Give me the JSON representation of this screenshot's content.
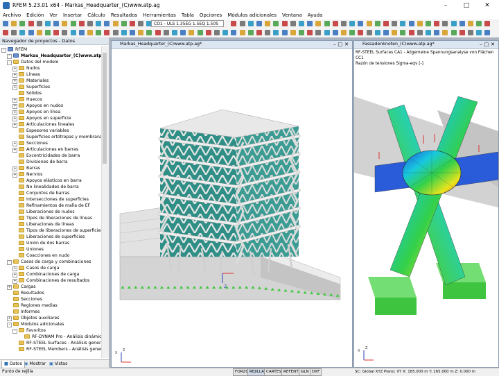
{
  "app": {
    "title": "RFEM 5.23.01 x64 - Markas_Headquarter_(C)www.atp.ag"
  },
  "menu": [
    "Archivo",
    "Edición",
    "Ver",
    "Insertar",
    "Cálculo",
    "Resultados",
    "Herramientas",
    "Tabla",
    "Opciones",
    "Módulos adicionales",
    "Ventana",
    "Ayuda"
  ],
  "toolbar": {
    "load_combo": "CO1 - ULS 1.35EG 1.5EQ 1.50S"
  },
  "navigator": {
    "title": "Navegador de proyectos - Datos",
    "root": "RFEM",
    "project": "Markas_Headquarter_(C)www.atp.ag*",
    "items": [
      {
        "label": "Datos del modelo",
        "level": 2,
        "exp": "-"
      },
      {
        "label": "Nudos",
        "level": 3,
        "exp": "+"
      },
      {
        "label": "Líneas",
        "level": 3,
        "exp": "+"
      },
      {
        "label": "Materiales",
        "level": 3,
        "exp": "+"
      },
      {
        "label": "Superficies",
        "level": 3,
        "exp": "+"
      },
      {
        "label": "Sólidos",
        "level": 3,
        "exp": ""
      },
      {
        "label": "Huecos",
        "level": 3,
        "exp": "+"
      },
      {
        "label": "Apoyos en nudos",
        "level": 3,
        "exp": "+"
      },
      {
        "label": "Apoyos en línea",
        "level": 3,
        "exp": "+"
      },
      {
        "label": "Apoyos en superficie",
        "level": 3,
        "exp": "+"
      },
      {
        "label": "Articulaciones lineales",
        "level": 3,
        "exp": "+"
      },
      {
        "label": "Espesores variables",
        "level": 3,
        "exp": ""
      },
      {
        "label": "Superficies ortótropas y membranas",
        "level": 3,
        "exp": ""
      },
      {
        "label": "Secciones",
        "level": 3,
        "exp": "+"
      },
      {
        "label": "Articulaciones en barras",
        "level": 3,
        "exp": "+"
      },
      {
        "label": "Excentricidades de barra",
        "level": 3,
        "exp": ""
      },
      {
        "label": "Divisiones de barra",
        "level": 3,
        "exp": ""
      },
      {
        "label": "Barras",
        "level": 3,
        "exp": "+"
      },
      {
        "label": "Nervios",
        "level": 3,
        "exp": "+"
      },
      {
        "label": "Apoyos elásticos en barra",
        "level": 3,
        "exp": ""
      },
      {
        "label": "No linealidades de barra",
        "level": 3,
        "exp": ""
      },
      {
        "label": "Conjuntos de barras",
        "level": 3,
        "exp": ""
      },
      {
        "label": "Intersecciones de superficies",
        "level": 3,
        "exp": ""
      },
      {
        "label": "Refinamientos de malla de EF",
        "level": 3,
        "exp": ""
      },
      {
        "label": "Liberaciones de nudos",
        "level": 3,
        "exp": ""
      },
      {
        "label": "Tipos de liberaciones de líneas",
        "level": 3,
        "exp": ""
      },
      {
        "label": "Liberaciones de líneas",
        "level": 3,
        "exp": ""
      },
      {
        "label": "Tipos de liberaciones de superficies",
        "level": 3,
        "exp": ""
      },
      {
        "label": "Liberaciones de superficies",
        "level": 3,
        "exp": ""
      },
      {
        "label": "Unión de dos barras",
        "level": 3,
        "exp": ""
      },
      {
        "label": "Uniones",
        "level": 3,
        "exp": ""
      },
      {
        "label": "Coacciones en nudo",
        "level": 3,
        "exp": ""
      },
      {
        "label": "Casos de carga y combinaciones",
        "level": 2,
        "exp": "-"
      },
      {
        "label": "Casos de carga",
        "level": 3,
        "exp": "+"
      },
      {
        "label": "Combinaciones de carga",
        "level": 3,
        "exp": "+"
      },
      {
        "label": "Combinaciones de resultados",
        "level": 3,
        "exp": "+"
      },
      {
        "label": "Cargas",
        "level": 2,
        "exp": "+"
      },
      {
        "label": "Resultados",
        "level": 2,
        "exp": ""
      },
      {
        "label": "Secciones",
        "level": 2,
        "exp": ""
      },
      {
        "label": "Regiones medias",
        "level": 2,
        "exp": ""
      },
      {
        "label": "Informes",
        "level": 2,
        "exp": ""
      },
      {
        "label": "Objetos auxiliares",
        "level": 2,
        "exp": "+"
      },
      {
        "label": "Módulos adicionales",
        "level": 2,
        "exp": "-"
      },
      {
        "label": "Favoritos",
        "level": 3,
        "exp": "-"
      },
      {
        "label": "RF-DYNAM Pro - Análisis dinámic",
        "level": 4,
        "exp": ""
      },
      {
        "label": "RF-STEEL Surfaces - Análisis general d",
        "level": 3,
        "exp": ""
      },
      {
        "label": "RF-STEEL Members - Análisis general d",
        "level": 3,
        "exp": ""
      }
    ],
    "tabs": [
      "Datos",
      "Mostrar",
      "Vistas"
    ]
  },
  "left_view": {
    "title": "Markas_Headquarter_(C)www.atp.ag*"
  },
  "right_view": {
    "title": "Fassadenknoten_(C)www.atp.ag*",
    "info": [
      "RF-STEEL Surfaces CA1 - Allgemeine Spannungsanalyse von Flächen",
      "CC1",
      "Razón de tensiones Sigma-eqv [-]"
    ]
  },
  "status": {
    "text": "Punto de rejilla",
    "buttons": [
      "FORZC",
      "REJILLA",
      "CARTES",
      "REFENT",
      "GLN",
      "DXF"
    ],
    "coords": "SC: Global XYZ     Plano: XY     X: 185.000 m   Y: 265.000 m   Z: 0.000 m"
  },
  "colors": {
    "accent": "#2a6fb3",
    "glass": "#2f8f86",
    "support": "#3ec83e",
    "load_arrow": "#e03030"
  }
}
